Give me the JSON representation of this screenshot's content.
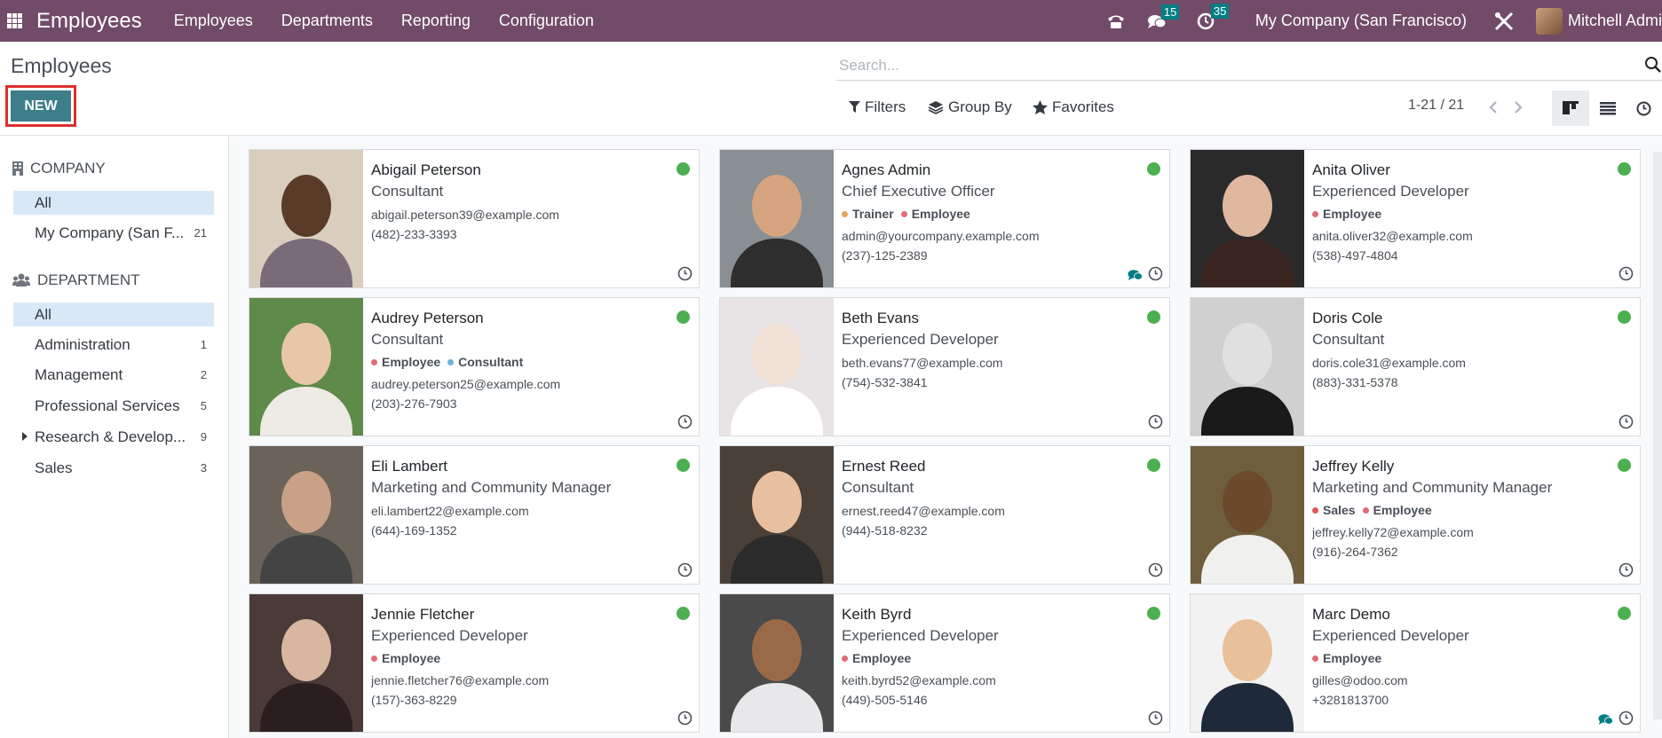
{
  "topbar": {
    "app_name": "Employees",
    "menu": [
      "Employees",
      "Departments",
      "Reporting",
      "Configuration"
    ],
    "messages_count": "15",
    "activities_count": "35",
    "company": "My Company (San Francisco)",
    "user": "Mitchell Admi"
  },
  "control": {
    "title": "Employees",
    "new_label": "NEW",
    "search_placeholder": "Search...",
    "filters_label": "Filters",
    "groupby_label": "Group By",
    "favorites_label": "Favorites",
    "pager": "1-21 / 21"
  },
  "sidebar": {
    "company_heading": "COMPANY",
    "company_items": [
      {
        "label": "All",
        "count": ""
      },
      {
        "label": "My Company (San F...",
        "count": "21"
      }
    ],
    "department_heading": "DEPARTMENT",
    "department_items": [
      {
        "label": "All",
        "count": ""
      },
      {
        "label": "Administration",
        "count": "1"
      },
      {
        "label": "Management",
        "count": "2"
      },
      {
        "label": "Professional Services",
        "count": "5"
      },
      {
        "label": "Research & Develop...",
        "count": "9"
      },
      {
        "label": "Sales",
        "count": "3"
      }
    ]
  },
  "employees": [
    {
      "name": "Abigail Peterson",
      "job": "Consultant",
      "tags": [],
      "email": "abigail.peterson39@example.com",
      "phone": "(482)-233-3393",
      "chat": false
    },
    {
      "name": "Agnes Admin",
      "job": "Chief Executive Officer",
      "tags": [
        {
          "label": "Trainer",
          "color": "#e8a35c"
        },
        {
          "label": "Employee",
          "color": "#e06c75"
        }
      ],
      "email": "admin@yourcompany.example.com",
      "phone": "(237)-125-2389",
      "chat": true
    },
    {
      "name": "Anita Oliver",
      "job": "Experienced Developer",
      "tags": [
        {
          "label": "Employee",
          "color": "#e06c75"
        }
      ],
      "email": "anita.oliver32@example.com",
      "phone": "(538)-497-4804",
      "chat": false
    },
    {
      "name": "Audrey Peterson",
      "job": "Consultant",
      "tags": [
        {
          "label": "Employee",
          "color": "#e06c75"
        },
        {
          "label": "Consultant",
          "color": "#6cb2d8"
        }
      ],
      "email": "audrey.peterson25@example.com",
      "phone": "(203)-276-7903",
      "chat": false
    },
    {
      "name": "Beth Evans",
      "job": "Experienced Developer",
      "tags": [],
      "email": "beth.evans77@example.com",
      "phone": "(754)-532-3841",
      "chat": false
    },
    {
      "name": "Doris Cole",
      "job": "Consultant",
      "tags": [],
      "email": "doris.cole31@example.com",
      "phone": "(883)-331-5378",
      "chat": false
    },
    {
      "name": "Eli Lambert",
      "job": "Marketing and Community Manager",
      "tags": [],
      "email": "eli.lambert22@example.com",
      "phone": "(644)-169-1352",
      "chat": false
    },
    {
      "name": "Ernest Reed",
      "job": "Consultant",
      "tags": [],
      "email": "ernest.reed47@example.com",
      "phone": "(944)-518-8232",
      "chat": false
    },
    {
      "name": "Jeffrey Kelly",
      "job": "Marketing and Community Manager",
      "tags": [
        {
          "label": "Sales",
          "color": "#e05555"
        },
        {
          "label": "Employee",
          "color": "#e06c75"
        }
      ],
      "email": "jeffrey.kelly72@example.com",
      "phone": "(916)-264-7362",
      "chat": false
    },
    {
      "name": "Jennie Fletcher",
      "job": "Experienced Developer",
      "tags": [
        {
          "label": "Employee",
          "color": "#e06c75"
        }
      ],
      "email": "jennie.fletcher76@example.com",
      "phone": "(157)-363-8229",
      "chat": false
    },
    {
      "name": "Keith Byrd",
      "job": "Experienced Developer",
      "tags": [
        {
          "label": "Employee",
          "color": "#e06c75"
        }
      ],
      "email": "keith.byrd52@example.com",
      "phone": "(449)-505-5146",
      "chat": false
    },
    {
      "name": "Marc Demo",
      "job": "Experienced Developer",
      "tags": [
        {
          "label": "Employee",
          "color": "#e06c75"
        }
      ],
      "email": "gilles@odoo.com",
      "phone": "+3281813700",
      "chat": true
    }
  ],
  "colors": {
    "brand": "#714b67",
    "new_button": "#3d7e8a",
    "new_highlight": "#e02d2d",
    "status_present": "#4caf50",
    "badge": "#017e84"
  }
}
